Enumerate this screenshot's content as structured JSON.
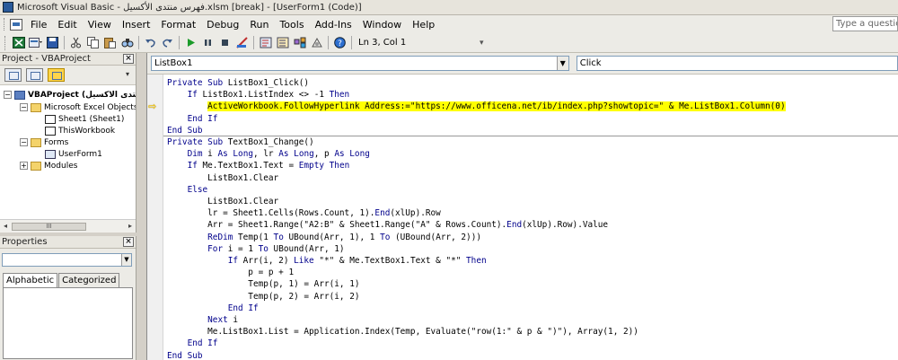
{
  "window": {
    "title": "Microsoft Visual Basic - فهرس منتدى الأكسيل.xlsm [break] - [UserForm1 (Code)]"
  },
  "menu": {
    "items": [
      "File",
      "Edit",
      "View",
      "Insert",
      "Format",
      "Debug",
      "Run",
      "Tools",
      "Add-Ins",
      "Window",
      "Help"
    ],
    "help_placeholder": "Type a question"
  },
  "toolbar": {
    "position_label": "Ln 3, Col 1",
    "icons": [
      "excel-icon",
      "insert-userform-icon",
      "save-icon",
      "cut-icon",
      "copy-icon",
      "paste-icon",
      "find-icon",
      "undo-icon",
      "redo-icon",
      "run-icon",
      "break-icon",
      "reset-icon",
      "design-mode-icon",
      "project-explorer-icon",
      "properties-icon",
      "object-browser-icon",
      "toolbox-icon",
      "help-icon"
    ]
  },
  "project_panel": {
    "title": "Project - VBAProject",
    "close": "×",
    "tree": [
      {
        "label": "VBAProject (فهرس منتدى الاكسيل",
        "toggle": "−",
        "icon": "vba",
        "bold": true
      },
      {
        "label": "Microsoft Excel Objects",
        "toggle": "−",
        "icon": "folder"
      },
      {
        "label": "Sheet1 (Sheet1)",
        "toggle": "",
        "icon": "sheet"
      },
      {
        "label": "ThisWorkbook",
        "toggle": "",
        "icon": "sheet"
      },
      {
        "label": "Forms",
        "toggle": "−",
        "icon": "folder"
      },
      {
        "label": "UserForm1",
        "toggle": "",
        "icon": "form"
      },
      {
        "label": "Modules",
        "toggle": "+",
        "icon": "folder"
      }
    ],
    "scroll_thumb": "III"
  },
  "properties_panel": {
    "title": "Properties",
    "close": "×",
    "tabs": [
      "Alphabetic",
      "Categorized"
    ]
  },
  "code_window": {
    "object_combo": "ListBox1",
    "procedure_combo": "Click",
    "exec_arrow": "⇨",
    "lines": [
      {
        "text": "Private Sub ListBox1_Click()"
      },
      {
        "text": "    If ListBox1.ListIndex <> -1 Then"
      },
      {
        "indent": "        ",
        "text": "ActiveWorkbook.FollowHyperlink Address:=\"https://www.officena.net/ib/index.php?showtopic=\" & Me.ListBox1.Column(0)",
        "highlight": true
      },
      {
        "text": "    End If"
      },
      {
        "text": "End Sub"
      },
      {
        "text": "Private Sub TextBox1_Change()"
      },
      {
        "text": "    Dim i As Long, lr As Long, p As Long"
      },
      {
        "text": "    If Me.TextBox1.Text = Empty Then"
      },
      {
        "text": "        ListBox1.Clear"
      },
      {
        "text": "    Else"
      },
      {
        "text": "        ListBox1.Clear"
      },
      {
        "text": "        lr = Sheet1.Cells(Rows.Count, 1).End(xlUp).Row"
      },
      {
        "text": "        Arr = Sheet1.Range(\"A2:B\" & Sheet1.Range(\"A\" & Rows.Count).End(xlUp).Row).Value"
      },
      {
        "text": "        ReDim Temp(1 To UBound(Arr, 1), 1 To (UBound(Arr, 2)))"
      },
      {
        "text": "        For i = 1 To UBound(Arr, 1)"
      },
      {
        "text": "            If Arr(i, 2) Like \"*\" & Me.TextBox1.Text & \"*\" Then"
      },
      {
        "text": "                p = p + 1"
      },
      {
        "text": "                Temp(p, 1) = Arr(i, 1)"
      },
      {
        "text": "                Temp(p, 2) = Arr(i, 2)"
      },
      {
        "text": "            End If"
      },
      {
        "text": "        Next i"
      },
      {
        "text": "        Me.ListBox1.List = Application.Index(Temp, Evaluate(\"row(1:\" & p & \")\"), Array(1, 2))"
      },
      {
        "text": "    End If"
      },
      {
        "text": "End Sub"
      }
    ]
  }
}
